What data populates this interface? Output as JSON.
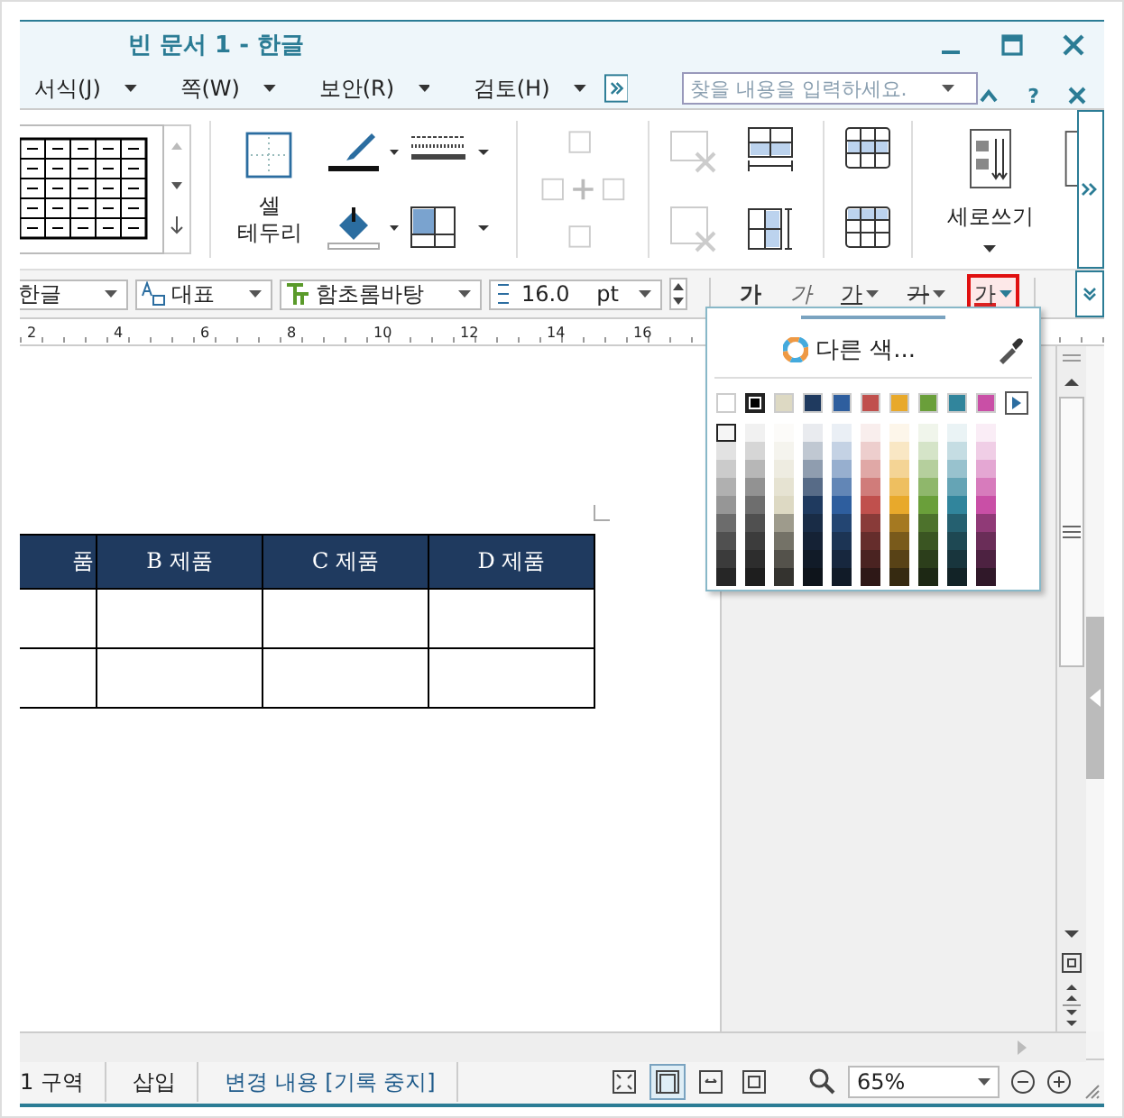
{
  "window": {
    "title": "빈 문서 1 - 한글"
  },
  "menu": [
    {
      "label": "서식(J)"
    },
    {
      "label": "쪽(W)"
    },
    {
      "label": "보안(R)"
    },
    {
      "label": "검토(H)"
    }
  ],
  "search": {
    "placeholder": "찾을 내용을 입력하세요."
  },
  "help": {
    "label": "?"
  },
  "ribbon": {
    "cell_border_label": [
      "셀",
      "테두리"
    ],
    "vertical_writing_label": "세로쓰기"
  },
  "format_bar": {
    "language": "한글",
    "style": "대표",
    "font": "함초롬바탕",
    "size": "16.0",
    "unit": "pt",
    "char_buttons": [
      {
        "kind": "bold",
        "label": "가",
        "selected": false
      },
      {
        "kind": "italic",
        "label": "가",
        "selected": false
      },
      {
        "kind": "underline",
        "label": "가",
        "selected": false
      },
      {
        "kind": "strike",
        "label": "가",
        "selected": false
      },
      {
        "kind": "color",
        "label": "가",
        "selected": true
      }
    ]
  },
  "ruler": [
    "2",
    "4",
    "6",
    "8",
    "10",
    "12",
    "14",
    "16"
  ],
  "table": {
    "columns": [
      "품",
      "B 제품",
      "C 제품",
      "D 제품"
    ],
    "rows": [
      {
        "kind": "blank"
      },
      {
        "kind": "blank"
      }
    ]
  },
  "color_popup": {
    "more_colors": "다른 색...",
    "swatches": [
      {
        "color": "#ffffff",
        "selected": false,
        "first_shade_selected": true
      },
      {
        "color": "#000000",
        "selected": true,
        "first_shade_selected": false
      },
      {
        "color": "#ddd9c3",
        "selected": false,
        "first_shade_selected": false
      },
      {
        "color": "#1f3a5f",
        "selected": false,
        "first_shade_selected": false
      },
      {
        "color": "#2e5e9e",
        "selected": false,
        "first_shade_selected": false
      },
      {
        "color": "#c0504d",
        "selected": false,
        "first_shade_selected": false
      },
      {
        "color": "#e8a92b",
        "selected": false,
        "first_shade_selected": false
      },
      {
        "color": "#6a9f3a",
        "selected": false,
        "first_shade_selected": false
      },
      {
        "color": "#31859c",
        "selected": false,
        "first_shade_selected": false
      },
      {
        "color": "#c94fa6",
        "selected": false,
        "first_shade_selected": false
      }
    ]
  },
  "status_bar": {
    "section": "1 구역",
    "mode": "삽입",
    "track_changes": "변경 내용 [기록 중지]",
    "view_buttons": [
      {
        "kind": "full",
        "selected": false
      },
      {
        "kind": "page",
        "selected": true
      },
      {
        "kind": "width",
        "selected": false
      },
      {
        "kind": "fit",
        "selected": false
      }
    ],
    "zoom": "65%"
  }
}
